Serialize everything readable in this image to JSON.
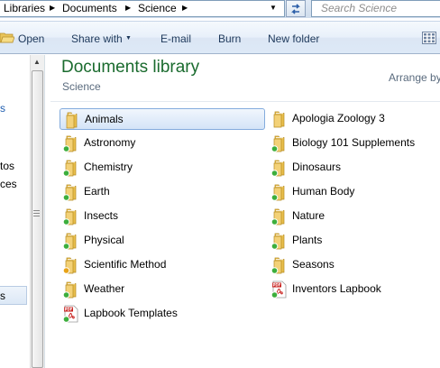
{
  "address": {
    "crumbs": [
      "Libraries",
      "Documents",
      "Science"
    ],
    "search_placeholder": "Search Science"
  },
  "toolbar": {
    "open_label": "Open",
    "share_label": "Share with",
    "email_label": "E-mail",
    "burn_label": "Burn",
    "new_folder_label": "New folder"
  },
  "nav": {
    "fragments": [
      "s",
      "tos",
      "ces",
      "s"
    ]
  },
  "library": {
    "title": "Documents library",
    "subtitle": "Science",
    "arrange_label": "Arrange by"
  },
  "items": [
    {
      "label": "Animals",
      "icon": "folder-icon",
      "status": "none"
    },
    {
      "label": "Apologia Zoology 3",
      "icon": "folder-icon",
      "status": "none"
    },
    {
      "label": "Astronomy",
      "icon": "folder-icon",
      "status": "synced"
    },
    {
      "label": "Biology 101 Supplements",
      "icon": "folder-icon",
      "status": "synced"
    },
    {
      "label": "Chemistry",
      "icon": "folder-icon",
      "status": "synced"
    },
    {
      "label": "Dinosaurs",
      "icon": "folder-icon",
      "status": "synced"
    },
    {
      "label": "Earth",
      "icon": "folder-icon",
      "status": "synced"
    },
    {
      "label": "Human Body",
      "icon": "folder-icon",
      "status": "synced"
    },
    {
      "label": "Insects",
      "icon": "folder-icon",
      "status": "synced"
    },
    {
      "label": "Nature",
      "icon": "folder-icon",
      "status": "synced"
    },
    {
      "label": "Physical",
      "icon": "folder-icon",
      "status": "synced"
    },
    {
      "label": "Plants",
      "icon": "folder-icon",
      "status": "synced"
    },
    {
      "label": "Scientific Method",
      "icon": "folder-icon",
      "status": "pending"
    },
    {
      "label": "Seasons",
      "icon": "folder-icon",
      "status": "synced"
    },
    {
      "label": "Weather",
      "icon": "folder-icon",
      "status": "synced"
    },
    {
      "label": "Inventors Lapbook",
      "icon": "pdf-icon",
      "status": "synced"
    },
    {
      "label": "Lapbook Templates",
      "icon": "pdf-icon",
      "status": "synced"
    }
  ],
  "colors": {
    "synced": "#3cae3c",
    "pending": "#e8a317",
    "folder": "#f3d177",
    "pdf": "#c8201d"
  }
}
